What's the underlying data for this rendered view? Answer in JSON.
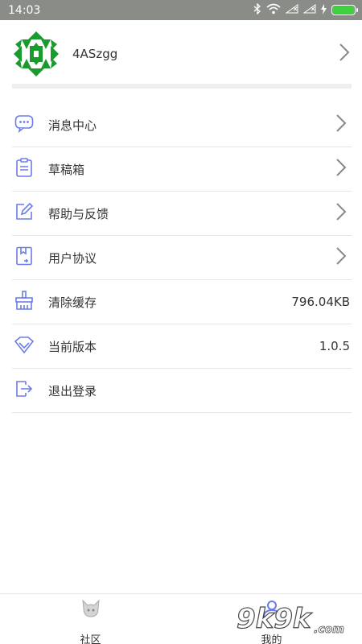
{
  "status_bar": {
    "time": "14:03"
  },
  "profile": {
    "username": "4ASzgg"
  },
  "menu": {
    "items": [
      {
        "label": "消息中心",
        "icon": "message-icon",
        "has_chevron": true
      },
      {
        "label": "草稿箱",
        "icon": "clipboard-icon",
        "has_chevron": true
      },
      {
        "label": "帮助与反馈",
        "icon": "edit-icon",
        "has_chevron": true
      },
      {
        "label": "用户协议",
        "icon": "document-icon",
        "has_chevron": true
      },
      {
        "label": "清除缓存",
        "icon": "broom-icon",
        "value": "796.04KB"
      },
      {
        "label": "当前版本",
        "icon": "diamond-icon",
        "value": "1.0.5"
      },
      {
        "label": "退出登录",
        "icon": "logout-icon"
      }
    ]
  },
  "bottom_nav": {
    "tabs": [
      {
        "label": "社区",
        "icon": "community-icon"
      },
      {
        "label": "我的",
        "icon": "profile-icon"
      }
    ]
  },
  "watermark": {
    "text": "9k9k.com"
  },
  "colors": {
    "accent": "#6b7ce8",
    "avatar_green": "#1a9b2d",
    "status_bar": "#8a8c87"
  }
}
